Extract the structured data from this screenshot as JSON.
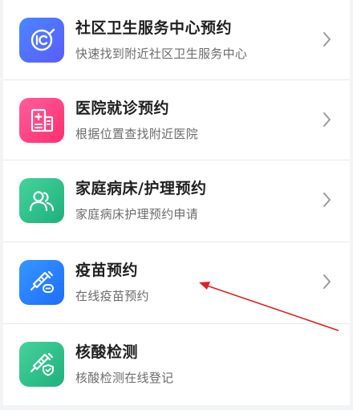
{
  "items": [
    {
      "title": "社区卫生服务中心预约",
      "subtitle": "快速找到附近社区卫生服务中心",
      "icon": "clinic-badge-icon",
      "color_from": "#3f7bff",
      "color_to": "#5d63ff"
    },
    {
      "title": "医院就诊预约",
      "subtitle": "根据位置查找附近医院",
      "icon": "hospital-building-icon",
      "color_from": "#ff4f90",
      "color_to": "#ff2e72"
    },
    {
      "title": "家庭病床/护理预约",
      "subtitle": "家庭病床护理预约申请",
      "icon": "people-icon",
      "color_from": "#3fcf95",
      "color_to": "#20b57f"
    },
    {
      "title": "疫苗预约",
      "subtitle": "在线疫苗预约",
      "icon": "syringe-icon",
      "color_from": "#2d8cff",
      "color_to": "#1f6fff"
    },
    {
      "title": "核酸检测",
      "subtitle": "核酸检测在线登记",
      "icon": "syringe-shield-icon",
      "color_from": "#3fcf95",
      "color_to": "#20b57f"
    }
  ],
  "annotation": {
    "color": "#e02020"
  }
}
